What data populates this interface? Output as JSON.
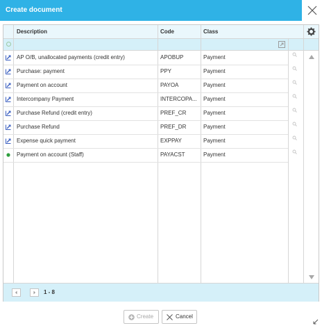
{
  "dialog": {
    "title": "Create document"
  },
  "columns": {
    "description": "Description",
    "code": "Code",
    "class": "Class"
  },
  "rows": [
    {
      "description": "AP O/B, unallocated payments (credit entry)",
      "code": "APOBUP",
      "class": "Payment",
      "icon": "edit-icon"
    },
    {
      "description": "Purchase: payment",
      "code": "PPY",
      "class": "Payment",
      "icon": "edit-icon"
    },
    {
      "description": "Payment on account",
      "code": "PAYOA",
      "class": "Payment",
      "icon": "edit-icon"
    },
    {
      "description": "Intercompany Payment",
      "code": "INTERCOPA...",
      "class": "Payment",
      "icon": "edit-icon"
    },
    {
      "description": "Purchase Refund (credit entry)",
      "code": "PREF_CR",
      "class": "Payment",
      "icon": "edit-icon"
    },
    {
      "description": "Purchase Refund",
      "code": "PREF_DR",
      "class": "Payment",
      "icon": "edit-icon"
    },
    {
      "description": "Expense quick payment",
      "code": "EXPPAY",
      "class": "Payment",
      "icon": "edit-icon"
    },
    {
      "description": "Payment on account (Staff)",
      "code": "PAYACST",
      "class": "Payment",
      "icon": "status-dot-icon"
    }
  ],
  "pager": {
    "range": "1 - 8"
  },
  "buttons": {
    "create": "Create",
    "cancel": "Cancel"
  },
  "colors": {
    "title_bar": "#2fb2e6",
    "header_bg": "#eaf7fc",
    "filter_bg": "#d5f0f9",
    "edit_icon": "#3b5fc0",
    "status_dot": "#2e9e3e"
  }
}
